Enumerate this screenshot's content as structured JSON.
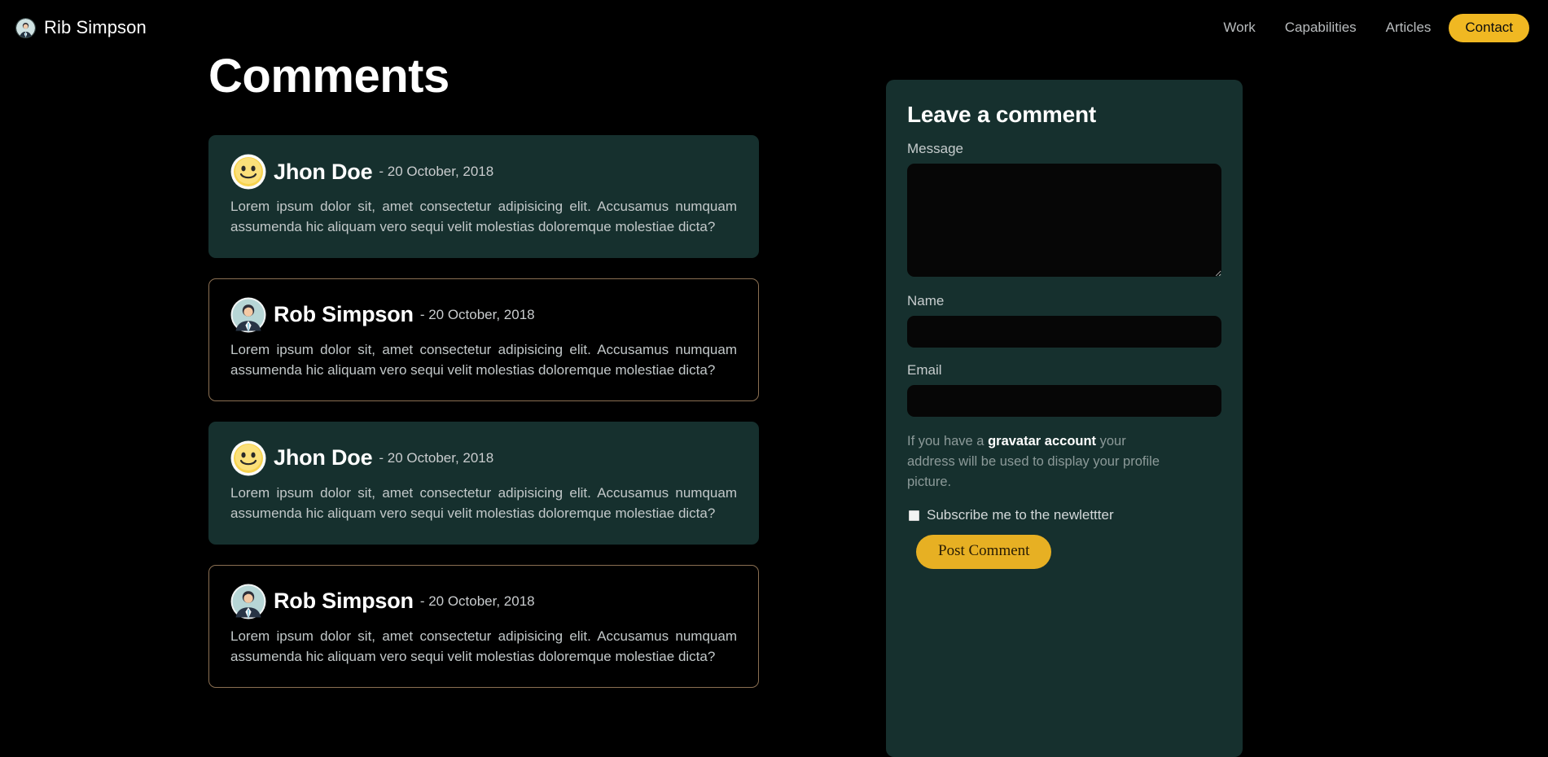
{
  "header": {
    "brand_name": "Rib Simpson",
    "brand_avatar_icon": "person-avatar-icon",
    "nav": [
      {
        "label": "Work",
        "name": "nav-link-work"
      },
      {
        "label": "Capabilities",
        "name": "nav-link-capabilities"
      },
      {
        "label": "Articles",
        "name": "nav-link-articles"
      }
    ],
    "cta_label": "Contact",
    "accent_color": "#f0b822"
  },
  "main": {
    "page_title": "Comments",
    "card_filled_bg": "#16302e",
    "card_outline_color": "#8a6f52",
    "comments": [
      {
        "author": "Jhon Doe",
        "date": "- 20 October, 2018",
        "avatar_icon": "smiley-face-avatar-icon",
        "style": "filled",
        "body": "Lorem ipsum dolor sit, amet consectetur adipisicing elit. Accusamus numquam assumenda hic aliquam vero sequi velit molestias doloremque molestiae dicta?"
      },
      {
        "author": "Rob Simpson",
        "date": "- 20 October, 2018",
        "avatar_icon": "businessman-avatar-icon",
        "style": "outlined",
        "body": "Lorem ipsum dolor sit, amet consectetur adipisicing elit. Accusamus numquam assumenda hic aliquam vero sequi velit molestias doloremque molestiae dicta?"
      },
      {
        "author": "Jhon Doe",
        "date": "- 20 October, 2018",
        "avatar_icon": "smiley-face-avatar-icon",
        "style": "filled",
        "body": "Lorem ipsum dolor sit, amet consectetur adipisicing elit. Accusamus numquam assumenda hic aliquam vero sequi velit molestias doloremque molestiae dicta?"
      },
      {
        "author": "Rob Simpson",
        "date": "- 20 October, 2018",
        "avatar_icon": "businessman-avatar-icon",
        "style": "outlined",
        "body": "Lorem ipsum dolor sit, amet consectetur adipisicing elit. Accusamus numquam assumenda hic aliquam vero sequi velit molestias doloremque molestiae dicta?"
      }
    ]
  },
  "form": {
    "title": "Leave a comment",
    "message_label": "Message",
    "message_value": "",
    "message_placeholder": "",
    "name_label": "Name",
    "name_value": "",
    "name_placeholder": "",
    "email_label": "Email",
    "email_value": "",
    "email_placeholder": "",
    "helper_prefix": "If you have a ",
    "helper_strong": "gravatar account",
    "helper_suffix": " your address will be used to display your profile picture.",
    "subscribe_label": "Subscribe me to the newlettter",
    "subscribe_checked": false,
    "submit_label": "Post Comment",
    "panel_bg": "#16302e",
    "input_bg": "#060606",
    "submit_color": "#e7b023"
  }
}
